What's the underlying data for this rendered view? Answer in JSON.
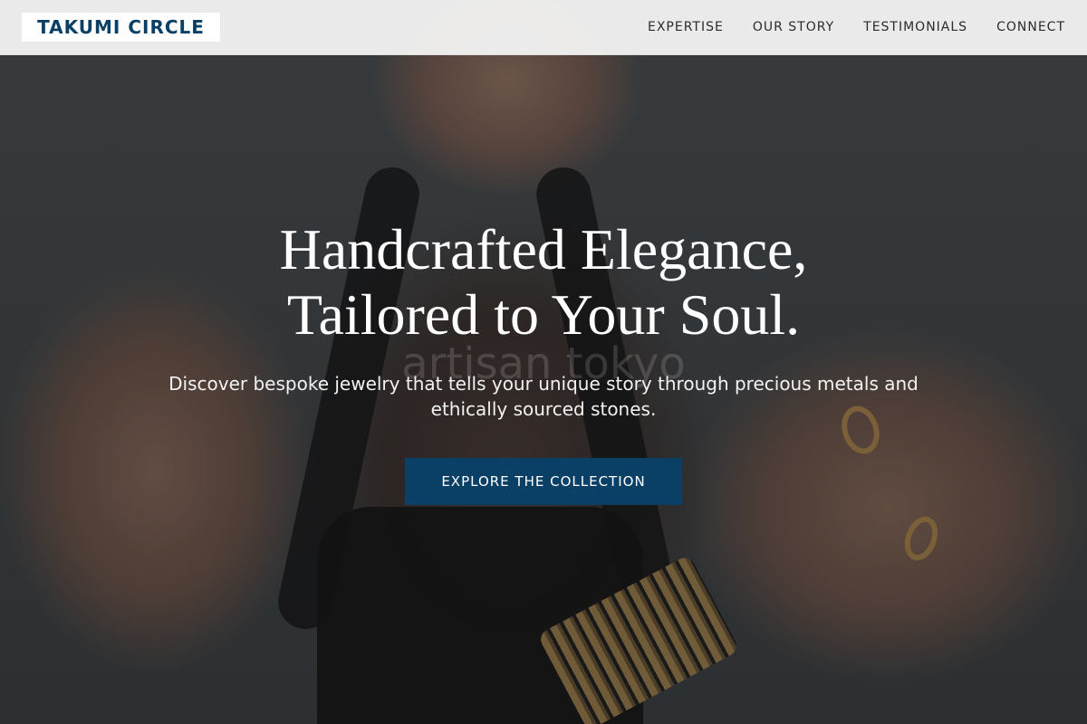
{
  "header": {
    "logo": "TAKUMI CIRCLE",
    "nav": [
      {
        "label": "EXPERTISE"
      },
      {
        "label": "OUR STORY"
      },
      {
        "label": "TESTIMONIALS"
      },
      {
        "label": "CONNECT"
      }
    ]
  },
  "hero": {
    "headline_line1": "Handcrafted Elegance,",
    "headline_line2": "Tailored to Your Soul.",
    "watermark": "artisan tokyo",
    "subtitle": "Discover bespoke jewelry that tells your unique story through precious metals and ethically sourced stones.",
    "cta_label": "EXPLORE THE COLLECTION"
  },
  "colors": {
    "brand": "#0a3f66",
    "header_bg": "#f5f5f5",
    "text_light": "#ffffff"
  }
}
